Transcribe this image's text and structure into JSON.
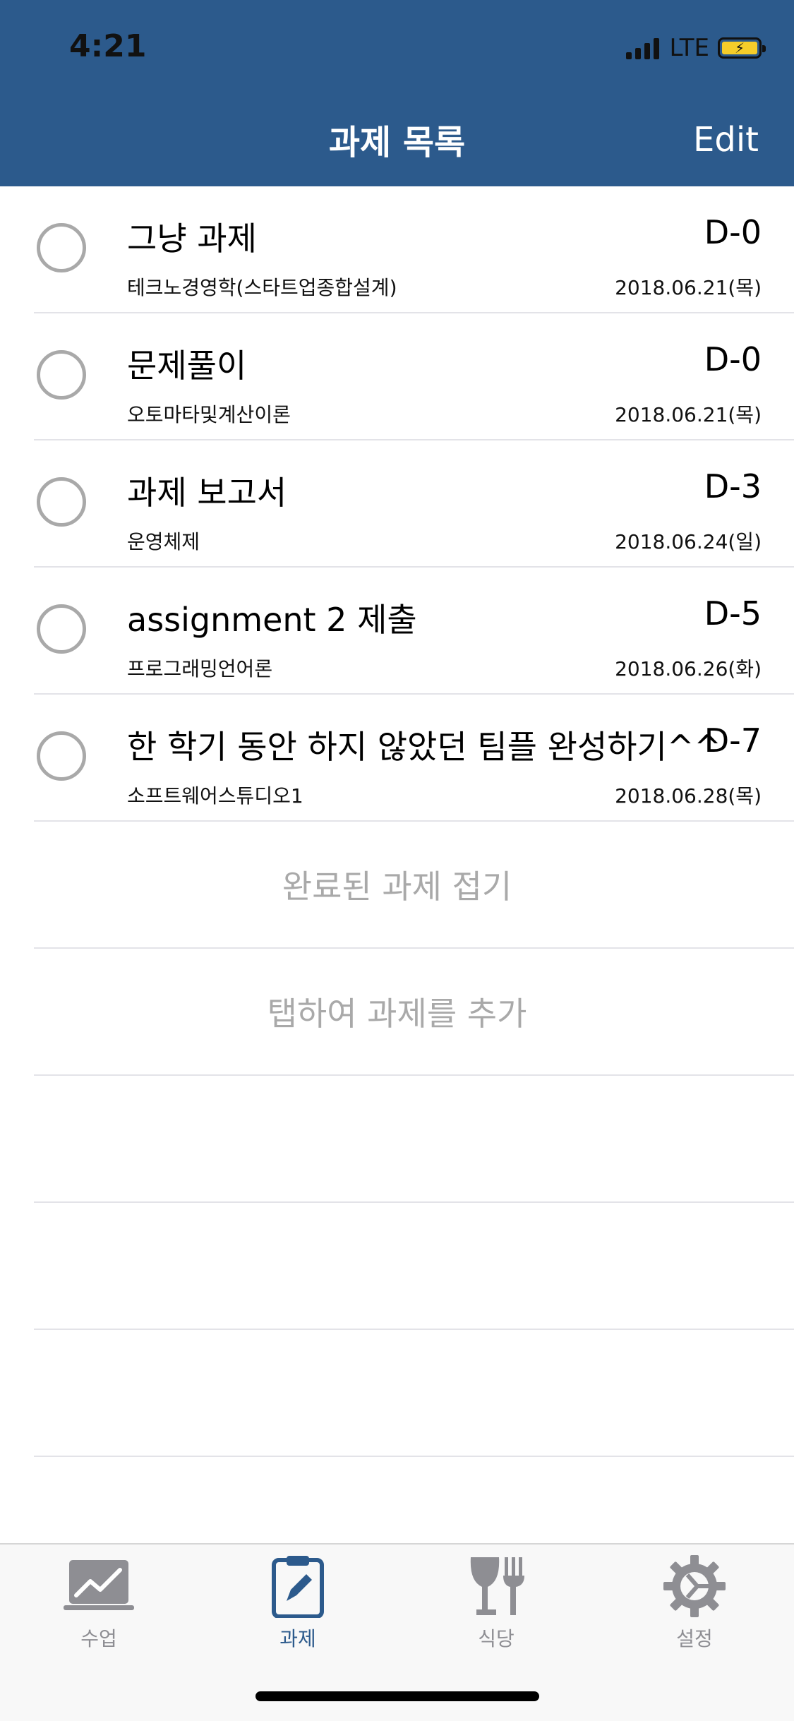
{
  "status_bar": {
    "time": "4:21",
    "network": "LTE"
  },
  "nav": {
    "title": "과제 목록",
    "edit": "Edit"
  },
  "tasks": [
    {
      "title": "그냥 과제",
      "subject": "테크노경영학(스타트업종합설계)",
      "dday": "D-0",
      "date": "2018.06.21(목)"
    },
    {
      "title": "문제풀이",
      "subject": "오토마타및계산이론",
      "dday": "D-0",
      "date": "2018.06.21(목)"
    },
    {
      "title": "과제 보고서",
      "subject": "운영체제",
      "dday": "D-3",
      "date": "2018.06.24(일)"
    },
    {
      "title": "assignment 2 제출",
      "subject": "프로그래밍언어론",
      "dday": "D-5",
      "date": "2018.06.26(화)"
    },
    {
      "title": "한 학기 동안 하지 않았던 팀플 완성하기^^",
      "subject": "소프트웨어스튜디오1",
      "dday": "D-7",
      "date": "2018.06.28(목)"
    }
  ],
  "actions": {
    "collapse_completed": "완료된 과제 접기",
    "add_task": "탭하여 과제를 추가"
  },
  "tabs": [
    {
      "label": "수업",
      "icon": "chart-icon",
      "active": false
    },
    {
      "label": "과제",
      "icon": "clipboard-pencil-icon",
      "active": true
    },
    {
      "label": "식당",
      "icon": "glass-fork-icon",
      "active": false
    },
    {
      "label": "설정",
      "icon": "gear-icon",
      "active": false
    }
  ],
  "colors": {
    "primary": "#2c5a8c",
    "inactive": "#8e8e93",
    "placeholder": "#a9a9a9"
  }
}
